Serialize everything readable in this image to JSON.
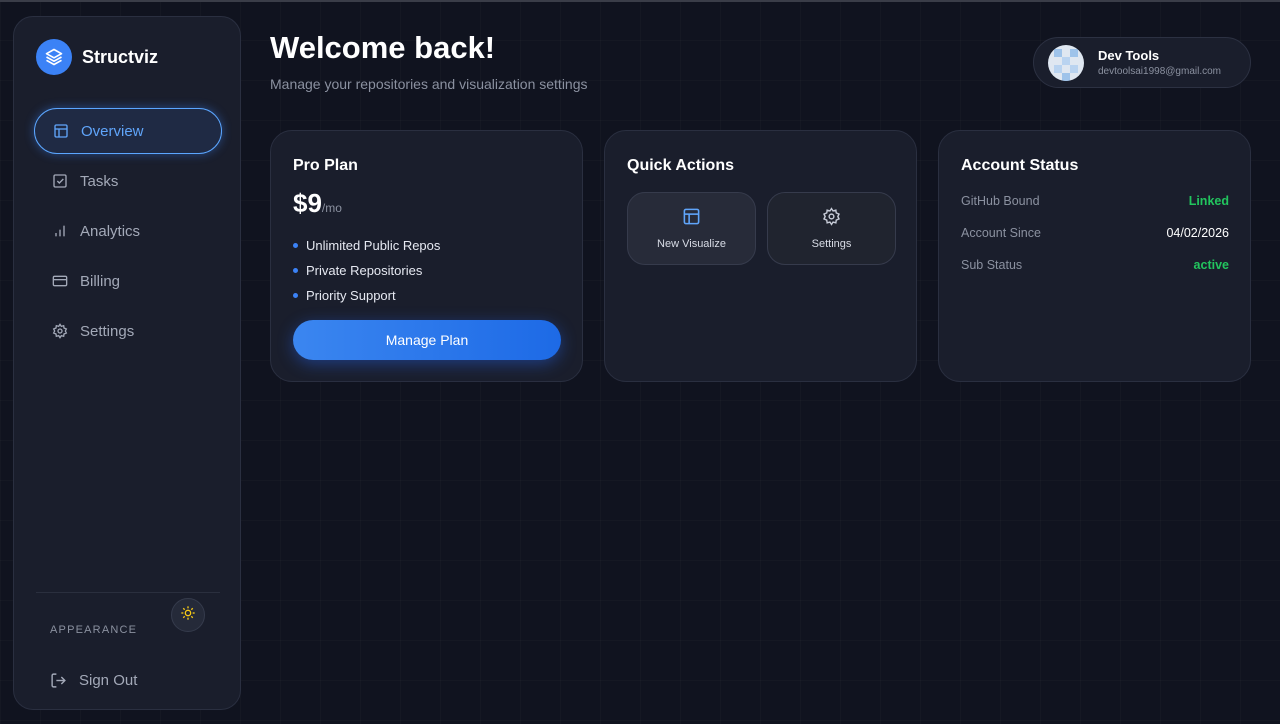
{
  "app": {
    "name": "Structviz"
  },
  "sidebar": {
    "items": [
      {
        "label": "Overview",
        "icon": "layout-icon",
        "active": true
      },
      {
        "label": "Tasks",
        "icon": "checkbox-icon",
        "active": false
      },
      {
        "label": "Analytics",
        "icon": "bar-chart-icon",
        "active": false
      },
      {
        "label": "Billing",
        "icon": "credit-card-icon",
        "active": false
      },
      {
        "label": "Settings",
        "icon": "gear-icon",
        "active": false
      }
    ],
    "appearance_label": "APPEARANCE",
    "theme_icon": "sun-icon",
    "signout_label": "Sign Out"
  },
  "header": {
    "title": "Welcome back!",
    "subtitle": "Manage your repositories and visualization settings"
  },
  "user": {
    "name": "Dev Tools",
    "email": "devtoolsai1998@gmail.com"
  },
  "plan_card": {
    "title": "Pro Plan",
    "price": "$9",
    "price_unit": "/mo",
    "features": [
      "Unlimited Public Repos",
      "Private Repositories",
      "Priority Support"
    ],
    "button_label": "Manage Plan"
  },
  "quick_actions": {
    "title": "Quick Actions",
    "actions": [
      {
        "label": "New Visualize",
        "icon": "layout-icon"
      },
      {
        "label": "Settings",
        "icon": "gear-icon"
      }
    ]
  },
  "account_status": {
    "title": "Account Status",
    "rows": [
      {
        "key": "GitHub Bound",
        "value": "Linked"
      },
      {
        "key": "Account Since",
        "value": "04/02/2026"
      },
      {
        "key": "Sub Status",
        "value": "active"
      }
    ]
  },
  "colors": {
    "accent": "#3b82f6",
    "success": "#22c55e",
    "background": "#10131f",
    "card": "#1a1e2c"
  }
}
